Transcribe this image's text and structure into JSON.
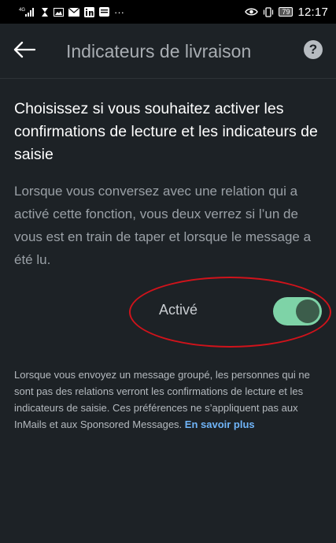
{
  "status_bar": {
    "network": "4G",
    "dots": "···",
    "battery": "79",
    "time": "12:17",
    "icons": [
      "signal-icon",
      "hourglass-icon",
      "photo-icon",
      "mail-icon",
      "linkedin-icon",
      "app-icon",
      "eye-icon",
      "vibrate-icon"
    ]
  },
  "app_bar": {
    "title": "Indicateurs de livraison",
    "help_symbol": "?"
  },
  "content": {
    "heading": "Choisissez si vous souhaitez activer les confirmations de lecture et les indicateurs de saisie",
    "description": "Lorsque vous conversez avec une relation qui a activé cette fonction, vous deux verrez si l’un de vous est en train de taper et lorsque le message a été lu.",
    "toggle": {
      "label": "Activé",
      "state": true
    },
    "footnote": "Lorsque vous envoyez un message groupé, les personnes qui ne sont pas des relations verront les confirmations de lecture et les indicateurs de saisie. Ces préférences ne s’appliquent pas aux InMails et aux Sponsored Messages.",
    "learn_more": "En savoir plus"
  },
  "colors": {
    "background": "#1d2226",
    "toggle_track": "#7ed3a7",
    "toggle_knob": "#3c5d4b",
    "link": "#70b5f9",
    "annotation": "#d0131b"
  }
}
